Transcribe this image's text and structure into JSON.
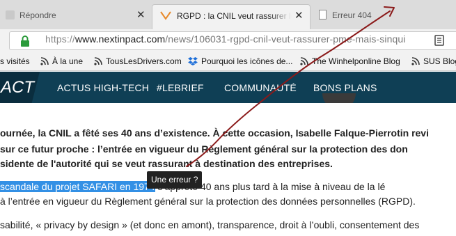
{
  "tabs": [
    {
      "label": "Répondre",
      "close": "✕"
    },
    {
      "label": "RGPD : la CNIL veut rassurer les P",
      "close": "✕"
    },
    {
      "label": "Erreur 404"
    }
  ],
  "toolbar": {
    "url_scheme": "https://",
    "url_host": "www.nextinpact.com",
    "url_path": "/news/106031-rgpd-cnil-veut-rassurer-pme-mais-sinqui"
  },
  "bookmarks": [
    {
      "label": "s visités"
    },
    {
      "label": "À la une"
    },
    {
      "label": "TousLesDrivers.com"
    },
    {
      "label": "Pourquoi les icônes de..."
    },
    {
      "label": "The Winhelponline Blog"
    },
    {
      "label": "SUS Blog"
    }
  ],
  "site_nav": {
    "logo_text": "ACT",
    "items": [
      "ACTUS HIGH-TECH",
      "#LEBRIEF",
      "COMMUNAUTÉ",
      "BONS PLANS"
    ]
  },
  "article": {
    "intro_lines": [
      "ournée, la CNIL a fêté ses 40 ans d’existence. À cette occasion, Isabelle Falque-Pierrotin revi",
      " sur ce futur proche : l’entrée en vigueur du Règlement général sur la protection des don",
      "sidente de l'autorité qui se veut rassurant à destination des entreprises."
    ],
    "p2_highlight": "scandale du projet SAFARI en 1974",
    "p2_rest": " s’apprête 40 ans plus tard à la mise à niveau de la lé",
    "p2_line2": "à l’entrée en vigueur du Règlement général sur la protection des données personnelles (RGPD).",
    "p3_line1": "sabilité, « privacy by design » (et donc en amont), transparence, droit à l’oubli, consentement des"
  },
  "tooltip": "Une erreur ?",
  "colors": {
    "nav_bg": "#0f3f55",
    "selection": "#3390e5",
    "gesture_line": "#8b1a1a",
    "tab_accent": "#e8892a",
    "lock": "#2a9a3a"
  }
}
